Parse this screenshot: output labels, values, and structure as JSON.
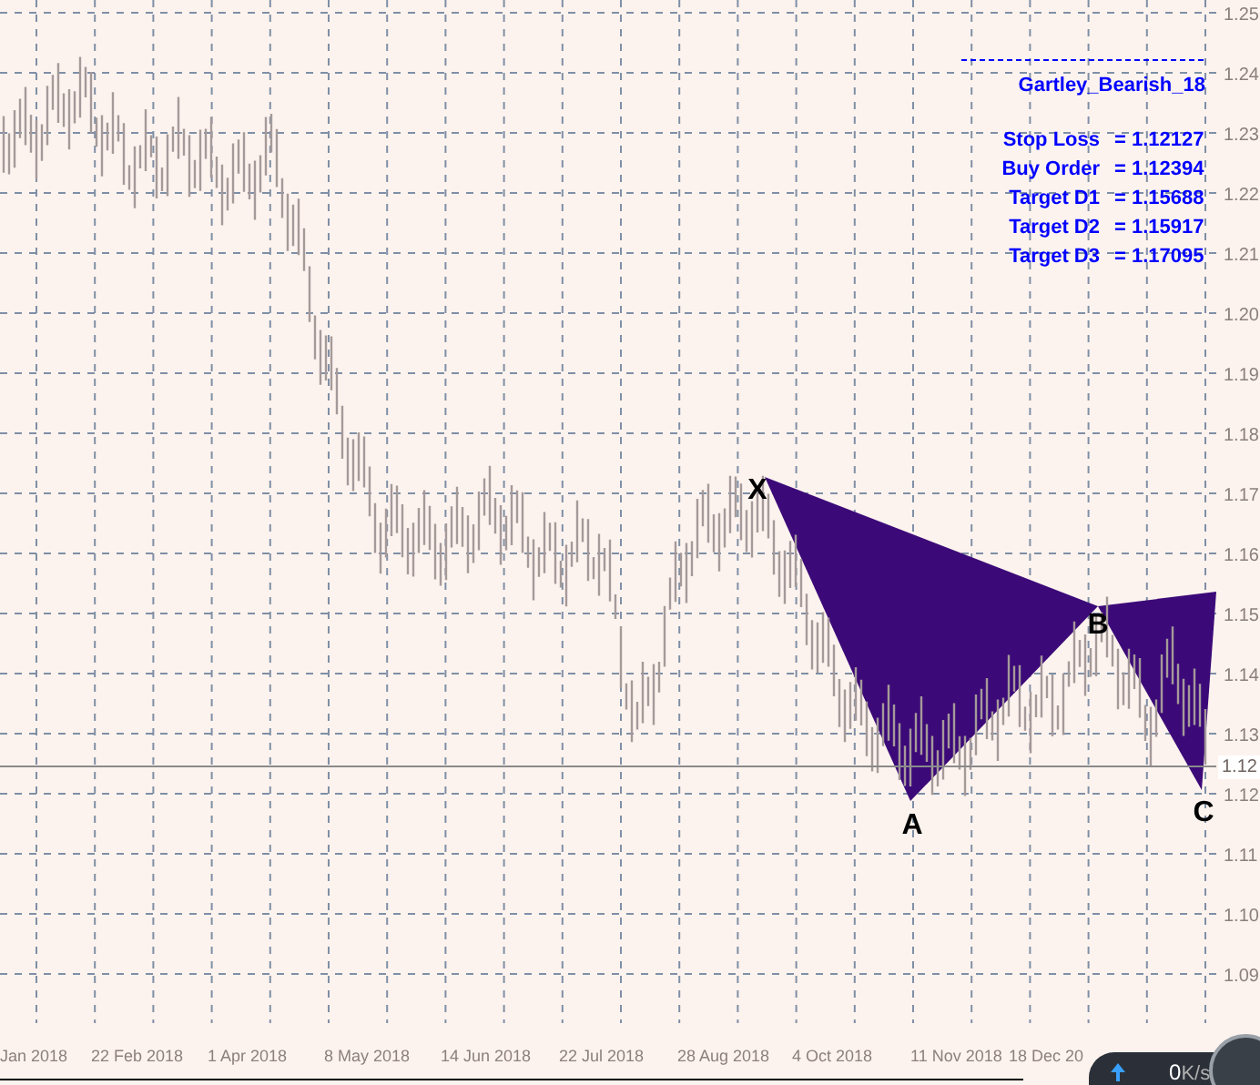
{
  "pattern": {
    "name": "Gartley_Bearish_18",
    "levels": [
      {
        "label": "Stop Loss",
        "value": "= 1.12127"
      },
      {
        "label": "Buy Order",
        "value": "= 1.12394"
      },
      {
        "label": "Target D1",
        "value": "= 1.15688"
      },
      {
        "label": "Target D2",
        "value": "= 1.15917"
      },
      {
        "label": "Target D3",
        "value": "= 1.17095"
      }
    ],
    "points": [
      {
        "label": "X"
      },
      {
        "label": "A"
      },
      {
        "label": "B"
      },
      {
        "label": "C"
      }
    ]
  },
  "price_axis": {
    "labels": [
      "1.25",
      "1.24",
      "1.23",
      "1.22",
      "1.21",
      "1.20",
      "1.19",
      "1.18",
      "1.17",
      "1.16",
      "1.15",
      "1.14",
      "1.13",
      "1.12",
      "1.11",
      "1.10",
      "1.09"
    ],
    "current_price": "1.12"
  },
  "time_axis": {
    "labels": [
      "Jan 2018",
      "22 Feb 2018",
      "1 Apr 2018",
      "8 May 2018",
      "14 Jun 2018",
      "22 Jul 2018",
      "28 Aug 2018",
      "4 Oct 2018",
      "11 Nov 2018",
      "18 Dec 20"
    ]
  },
  "status_widget": {
    "speed": "0",
    "unit": "K/s"
  }
}
